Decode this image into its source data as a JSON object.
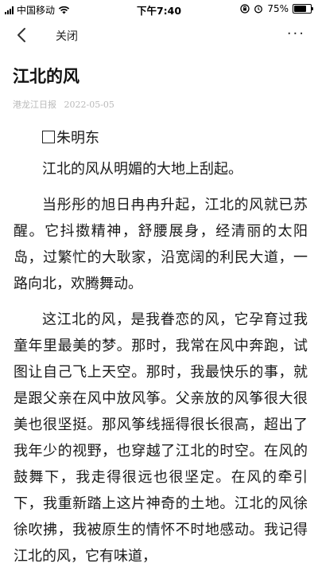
{
  "status_bar": {
    "carrier": "中国移动",
    "time": "下午7:40",
    "battery_percent": "75%",
    "battery_level": 0.75,
    "icons": [
      "signal-icon",
      "wifi-icon",
      "lock-rotation-icon",
      "alarm-icon",
      "battery-icon"
    ]
  },
  "nav": {
    "back_icon": "chevron-left-icon",
    "close_label": "关闭",
    "more_icon": "more-dots-icon",
    "more_label": "···"
  },
  "article": {
    "title": "江北的风",
    "source": "港龙江日报",
    "date": "2022-05-05",
    "author": "朱明东",
    "paragraphs": [
      "江北的风从明媚的大地上刮起。",
      "当彤彤的旭日冉冉升起，江北的风就已苏醒。它抖擞精神，舒腰展身，经清丽的太阳岛，过繁忙的大耿家，沿宽阔的利民大道，一路向北，欢腾舞动。",
      "这江北的风，是我眷恋的风，它孕育过我童年里最美的梦。那时，我常在风中奔跑，试图让自己飞上天空。那时，我最快乐的事，就是跟父亲在风中放风筝。父亲放的风筝很大很美也很坚挺。那风筝线摇得很长很高，超出了我年少的视野，也穿越了江北的时空。在风的鼓舞下，我走得很远也很坚定。在风的牵引下，我重新踏上这片神奇的土地。江北的风徐徐吹拂，我被原生的情怀不时地感动。我记得江北的风，它有味道，"
    ]
  }
}
